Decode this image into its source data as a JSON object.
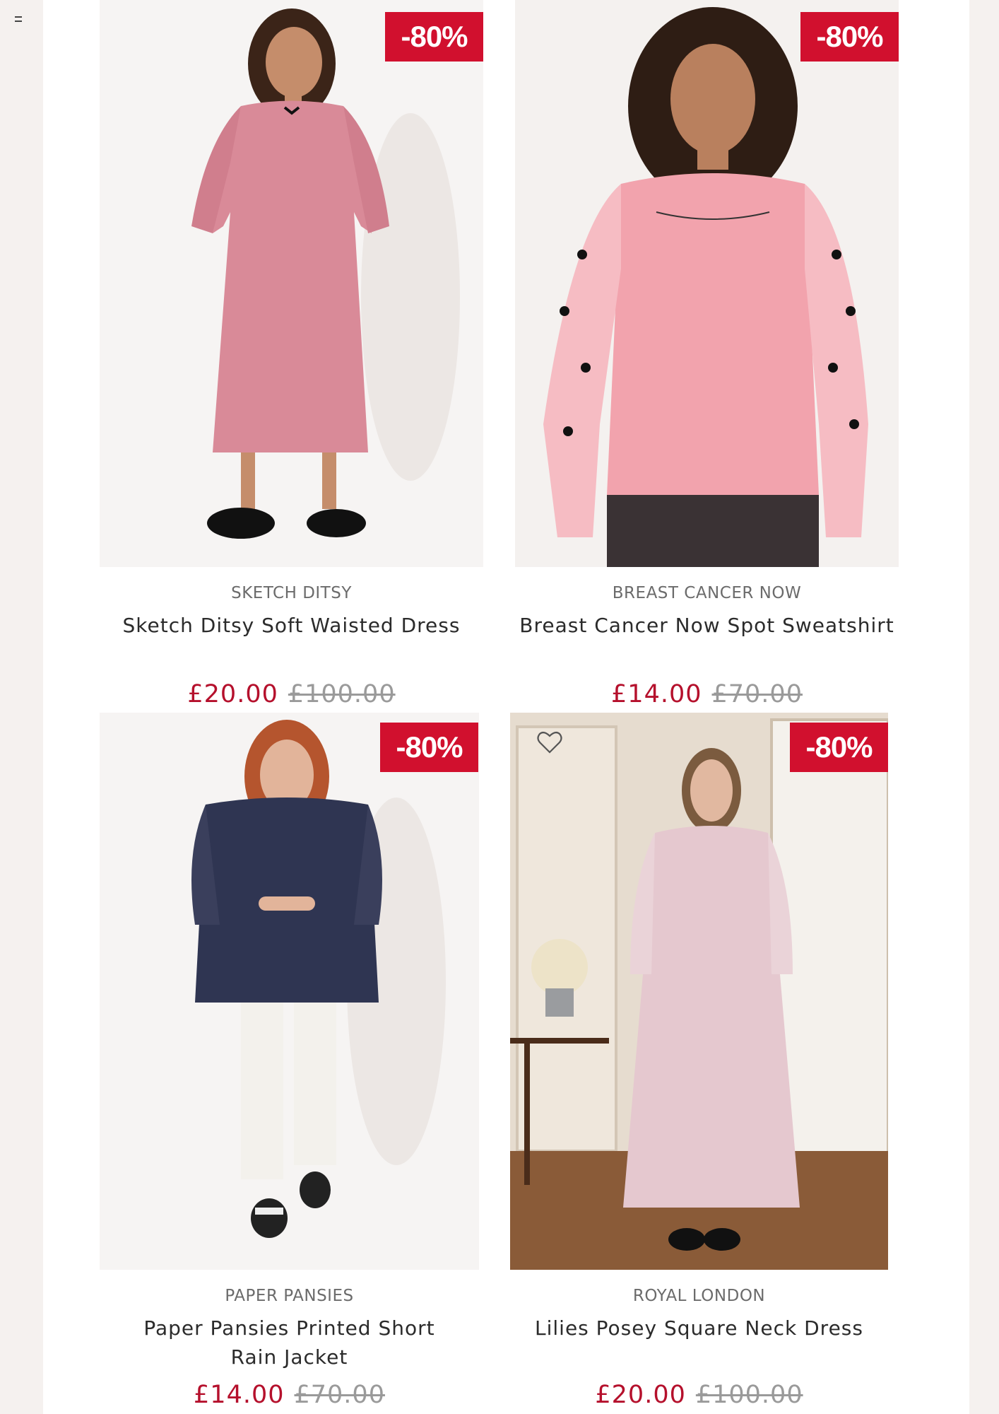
{
  "colors": {
    "badge": "#d1102e",
    "sale_price": "#b5102c",
    "old_price": "#9a9a9a",
    "brand": "#6b6b6b"
  },
  "icons": {
    "menu": "menu-icon",
    "wishlist": "heart-outline-icon"
  },
  "products": [
    {
      "brand": "SKETCH DITSY",
      "title": "Sketch Ditsy Soft Waisted Dress",
      "price": "£20.00",
      "old_price": "£100.00",
      "discount": "-80%"
    },
    {
      "brand": "BREAST CANCER NOW",
      "title": "Breast Cancer Now Spot Sweatshirt",
      "price": "£14.00",
      "old_price": "£70.00",
      "discount": "-80%"
    },
    {
      "brand": "PAPER PANSIES",
      "title": "Paper Pansies Printed Short Rain Jacket",
      "price": "£14.00",
      "old_price": "£70.00",
      "discount": "-80%"
    },
    {
      "brand": "ROYAL LONDON",
      "title": "Lilies Posey Square Neck Dress",
      "price": "£20.00",
      "old_price": "£100.00",
      "discount": "-80%"
    }
  ]
}
